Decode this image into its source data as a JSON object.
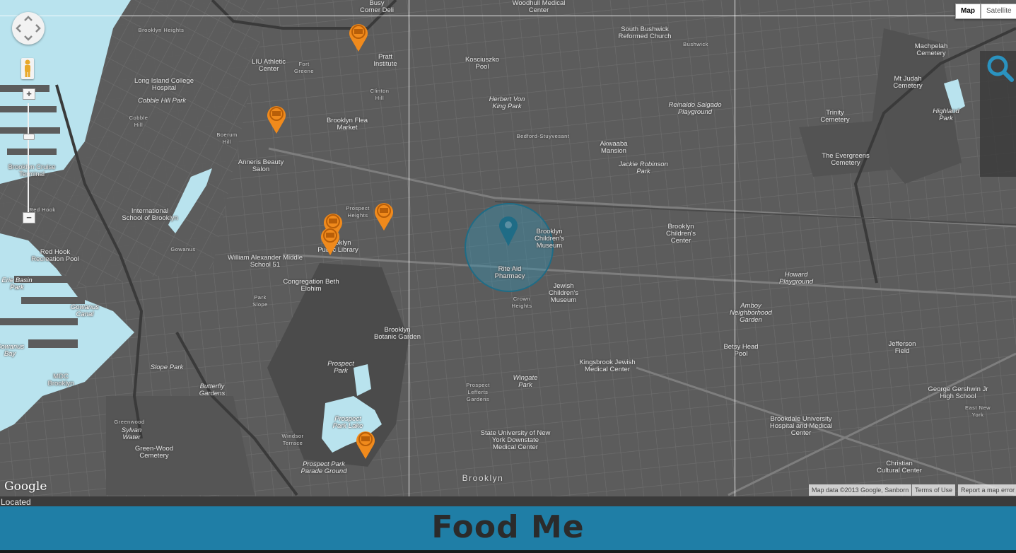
{
  "map": {
    "type_control": {
      "map_label": "Map",
      "satellite_label": "Satellite",
      "active": "map"
    },
    "attribution": {
      "data": "Map data ©2013 Google, Sanborn",
      "terms": "Terms of Use",
      "report": "Report a map error"
    },
    "logo_text": "Google",
    "colors": {
      "land": "#5b5b5b",
      "water": "#b9e3ee",
      "park": "#4a4a4a",
      "marker_orange": "#f08a1c",
      "location_blue": "#1f6c86"
    },
    "place_labels": [
      "Brooklyn Heights",
      "Long Island College Hospital",
      "Cobble Hill Park",
      "Cobble Hill",
      "Brooklyn Cruise Terminal",
      "Red Hook",
      "International School of Brooklyn",
      "Red Hook Recreation Pool",
      "Erie Basin Park",
      "Gowanus Canal",
      "Gowanus Bay",
      "MDC Brooklyn",
      "Slope Park",
      "Butterfly Gardens",
      "Greenwood",
      "Sylvan Water",
      "Green-Wood Cemetery",
      "Windsor Terrace",
      "Prospect Park Parade Ground",
      "Prospect Park Lake",
      "Prospect Park",
      "Brooklyn Botanic Garden",
      "Park Slope",
      "Congregation Beth Elohim",
      "William Alexander Middle School 51",
      "Gowanus",
      "Prospect Heights",
      "Brooklyn Public Library",
      "Anneris Beauty Salon",
      "Boerum Hill",
      "Brooklyn Flea Market",
      "LIU Athletic Center",
      "Fort Greene",
      "Pratt Institute",
      "Clinton Hill",
      "Busy Corner Deli",
      "Woodhull Medical Center",
      "Kosciuszko Pool",
      "Herbert Von King Park",
      "Bedford-Stuyvesant",
      "South Bushwick Reformed Church",
      "Bushwick",
      "Reinaldo Salgado Playground",
      "Akwaaba Mansion",
      "Jackie Robinson Park",
      "Brooklyn Children's Museum",
      "Rite Aid Pharmacy",
      "Jewish Children's Museum",
      "Crown Heights",
      "Brooklyn Children's Center",
      "Howard Playground",
      "Amboy Neighborhood Garden",
      "Betsy Head Pool",
      "Kingsbrook Jewish Medical Center",
      "Wingate Park",
      "Prospect Lefferts Gardens",
      "State University of New York Downstate Medical Center",
      "Brooklyn",
      "Brookdale University Hospital and Medical Center",
      "Christian Cultural Center",
      "Jefferson Field",
      "George Gershwin Jr High School",
      "East New York",
      "Machpelah Cemetery",
      "Mt Judah Cemetery",
      "Highland Park",
      "Trinity Cemetery",
      "The Evergreens Cemetery"
    ],
    "truck_markers": 6
  },
  "status": {
    "text": "Located"
  },
  "app": {
    "title": "Food Me"
  }
}
